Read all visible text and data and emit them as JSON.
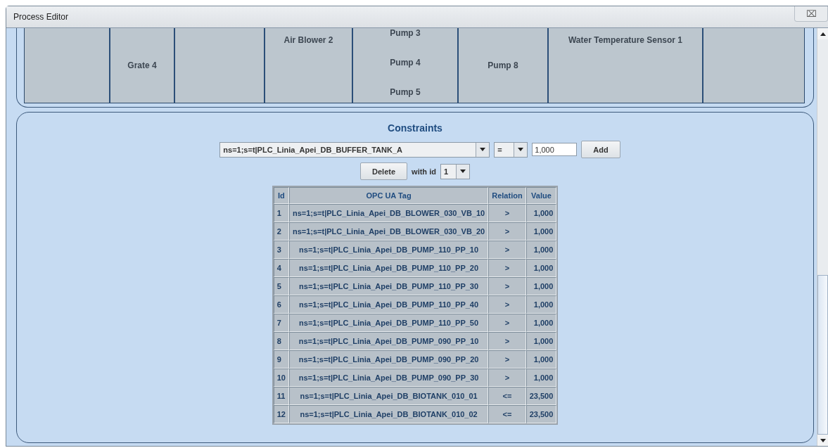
{
  "window": {
    "title": "Process Editor",
    "close": "⌧"
  },
  "devices": [
    {
      "kind": "empty"
    },
    {
      "kind": "centered",
      "items": [
        "Grate 4"
      ]
    },
    {
      "kind": "empty"
    },
    {
      "kind": "heading",
      "items": [
        "Air Blower 2"
      ]
    },
    {
      "kind": "stack",
      "items": [
        "Pump 3",
        "Pump 4",
        "Pump 5"
      ]
    },
    {
      "kind": "centered",
      "items": [
        "Pump 8"
      ]
    },
    {
      "kind": "heading",
      "items": [
        "Water Temperature Sensor 1"
      ]
    },
    {
      "kind": "empty"
    }
  ],
  "constraints": {
    "title": "Constraints",
    "tag_select": {
      "value": "ns=1;s=t|PLC_Linia_Apei_DB_BUFFER_TANK_A"
    },
    "relation_select": {
      "value": "="
    },
    "value_field": {
      "value": "1,000"
    },
    "add_button": "Add",
    "delete_button": "Delete",
    "with_id_label": "with id",
    "id_select": {
      "value": "1"
    },
    "table": {
      "columns": [
        "Id",
        "OPC UA Tag",
        "Relation",
        "Value"
      ],
      "rows": [
        [
          "1",
          "ns=1;s=t|PLC_Linia_Apei_DB_BLOWER_030_VB_10",
          ">",
          "1,000"
        ],
        [
          "2",
          "ns=1;s=t|PLC_Linia_Apei_DB_BLOWER_030_VB_20",
          ">",
          "1,000"
        ],
        [
          "3",
          "ns=1;s=t|PLC_Linia_Apei_DB_PUMP_110_PP_10",
          ">",
          "1,000"
        ],
        [
          "4",
          "ns=1;s=t|PLC_Linia_Apei_DB_PUMP_110_PP_20",
          ">",
          "1,000"
        ],
        [
          "5",
          "ns=1;s=t|PLC_Linia_Apei_DB_PUMP_110_PP_30",
          ">",
          "1,000"
        ],
        [
          "6",
          "ns=1;s=t|PLC_Linia_Apei_DB_PUMP_110_PP_40",
          ">",
          "1,000"
        ],
        [
          "7",
          "ns=1;s=t|PLC_Linia_Apei_DB_PUMP_110_PP_50",
          ">",
          "1,000"
        ],
        [
          "8",
          "ns=1;s=t|PLC_Linia_Apei_DB_PUMP_090_PP_10",
          ">",
          "1,000"
        ],
        [
          "9",
          "ns=1;s=t|PLC_Linia_Apei_DB_PUMP_090_PP_20",
          ">",
          "1,000"
        ],
        [
          "10",
          "ns=1;s=t|PLC_Linia_Apei_DB_PUMP_090_PP_30",
          ">",
          "1,000"
        ],
        [
          "11",
          "ns=1;s=t|PLC_Linia_Apei_DB_BIOTANK_010_01",
          "<=",
          "23,500"
        ],
        [
          "12",
          "ns=1;s=t|PLC_Linia_Apei_DB_BIOTANK_010_02",
          "<=",
          "23,500"
        ]
      ]
    }
  }
}
